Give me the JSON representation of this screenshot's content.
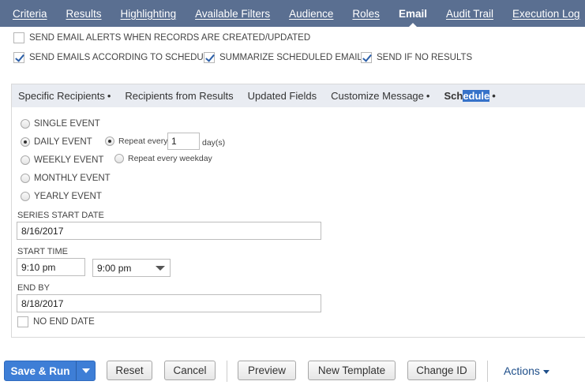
{
  "tabs": [
    "Criteria",
    "Results",
    "Highlighting",
    "Available Filters",
    "Audience",
    "Roles",
    "Email",
    "Audit Trail",
    "Execution Log"
  ],
  "active_tab": "Email",
  "email_options": {
    "alerts_label": "SEND EMAIL ALERTS WHEN RECORDS ARE CREATED/UPDATED",
    "alerts_checked": false,
    "schedule_label": "SEND EMAILS ACCORDING TO SCHEDULE",
    "schedule_checked": true,
    "summarize_label": "SUMMARIZE SCHEDULED EMAILS",
    "summarize_checked": true,
    "noresults_label": "SEND IF NO RESULTS",
    "noresults_checked": true
  },
  "subtabs": {
    "specific": "Specific Recipients",
    "from_results": "Recipients from Results",
    "updated": "Updated Fields",
    "customize": "Customize Message",
    "schedule_pre": "Sch",
    "schedule_sel": "edule",
    "dot": "•"
  },
  "schedule": {
    "single": "SINGLE EVENT",
    "daily": "DAILY EVENT",
    "weekly": "WEEKLY EVENT",
    "monthly": "MONTHLY EVENT",
    "yearly": "YEARLY EVENT",
    "selected": "DAILY EVENT",
    "repeat_every": "Repeat every",
    "repeat_value": "1",
    "repeat_unit": "day(s)",
    "repeat_weekday": "Repeat every weekday",
    "series_start_label": "SERIES START DATE",
    "series_start_value": "8/16/2017",
    "start_time_label": "START TIME",
    "start_time_value": "9:10 pm",
    "start_time_select": "9:00 pm",
    "end_by_label": "END BY",
    "end_by_value": "8/18/2017",
    "no_end_date_label": "NO END DATE",
    "no_end_date_checked": false
  },
  "buttons": {
    "save_run": "Save & Run",
    "reset": "Reset",
    "cancel": "Cancel",
    "preview": "Preview",
    "new_template": "New Template",
    "change_id": "Change ID",
    "actions": "Actions"
  },
  "colors": {
    "tabbar": "#5a6f91",
    "primary": "#3e7ed6",
    "subtab_bg": "#e9ecf2",
    "link": "#1f4f8a"
  }
}
